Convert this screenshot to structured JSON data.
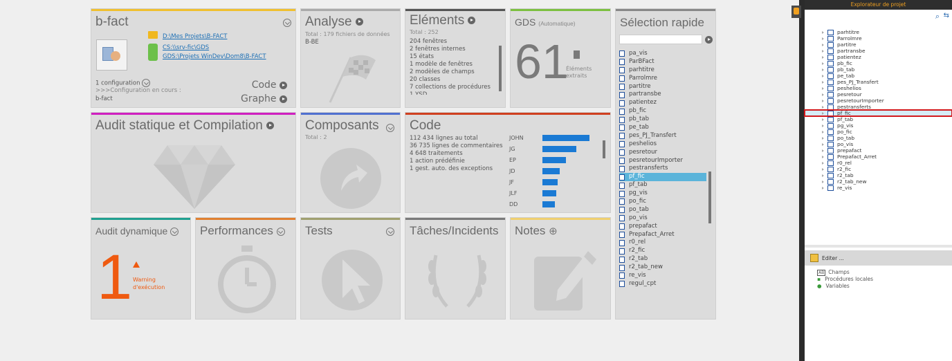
{
  "bfact": {
    "title": "b-fact",
    "paths": [
      "D:\\Mes Projets\\B-FACT",
      "CS:\\\\srv-fic\\GDS",
      "GDS:\\Projets WinDev\\Dom8\\B-FACT"
    ],
    "config_count": "1 configuration",
    "config_current": ">>>Configuration en cours :",
    "config_name": "b-fact",
    "code_label": "Code",
    "graphe_label": "Graphe",
    "accent": "#f0c030"
  },
  "analyse": {
    "title": "Analyse",
    "subtitle": "Total : 179 fichiers de données",
    "name": "B-BE",
    "accent": "#aaaaaa"
  },
  "elements": {
    "title": "Eléments",
    "total": "Total : 252",
    "lines": [
      "204 fenêtres",
      "2 fenêtres internes",
      "15 états",
      "1 modèle de fenêtres",
      "2 modèles de champs",
      "20 classes",
      "7 collections de procédures",
      "1 YSD"
    ],
    "accent": "#555555"
  },
  "gds": {
    "title": "GDS",
    "mode": "(Automatique)",
    "count": "61",
    "label1": "Éléments",
    "label2": "extraits",
    "accent": "#7cc040"
  },
  "selection": {
    "title": "Sélection rapide",
    "items": [
      "pa_vis",
      "ParBFact",
      "parhtitre",
      "Parrolmre",
      "partitre",
      "partransbe",
      "patientez",
      "pb_fic",
      "pb_tab",
      "pe_tab",
      "pes_PJ_Transfert",
      "peshelios",
      "pesretour",
      "pesretourImporter",
      "pestransferts",
      "pf_fic",
      "pf_tab",
      "pg_vis",
      "po_fic",
      "po_tab",
      "po_vis",
      "prepafact",
      "Prepafact_Arret",
      "r0_rel",
      "r2_fic",
      "r2_tab",
      "r2_tab_new",
      "re_vis",
      "regul_cpt"
    ],
    "selected": "pf_fic",
    "accent": "#888888"
  },
  "audit_statique": {
    "title": "Audit statique et Compilation",
    "accent": "#d020c0"
  },
  "composants": {
    "title": "Composants",
    "total": "Total : 2",
    "accent": "#5070d0"
  },
  "code": {
    "title": "Code",
    "lines": [
      "112 434 lignes au total",
      "36 735 lignes de commentaires",
      "4 648 traitements",
      "1 action prédéfinie",
      "1 gest. auto. des exceptions"
    ],
    "accent": "#d04020"
  },
  "chart_data": {
    "type": "bar",
    "categories": [
      "JOHN",
      "JG",
      "EP",
      "JD",
      "JF",
      "JLF",
      "DD"
    ],
    "values": [
      68,
      49,
      34,
      25,
      22,
      20,
      18
    ]
  },
  "audit_dynamique": {
    "title": "Audit dynamique",
    "count": "1",
    "warning1": "Warning",
    "warning2": "d'exécution",
    "accent": "#20a090"
  },
  "performances": {
    "title": "Performances",
    "accent": "#e08030"
  },
  "tests": {
    "title": "Tests",
    "accent": "#a0a070"
  },
  "taches": {
    "title": "Tâches/Incidents",
    "accent": "#7a7a7a"
  },
  "notes": {
    "title": "Notes",
    "accent": "#f0d070"
  },
  "explorer": {
    "title": "Explorateur de projet",
    "items": [
      "parhtitre",
      "Parrolmre",
      "partitre",
      "partransbe",
      "patientez",
      "pb_fic",
      "pb_tab",
      "pe_tab",
      "pes_PJ_Transfert",
      "peshelios",
      "pesretour",
      "pesretourImporter",
      "pestransferts",
      "pf_fic",
      "pf_tab",
      "pg_vis",
      "po_fic",
      "po_tab",
      "po_vis",
      "prepafact",
      "Prepafact_Arret",
      "r0_rel",
      "r2_fic",
      "r2_tab",
      "r2_tab_new",
      "re_vis"
    ],
    "selected": "pf_fic",
    "edit_label": "Editer ...",
    "bottom_items": [
      "Champs",
      "Procédures locales",
      "Variables"
    ]
  }
}
